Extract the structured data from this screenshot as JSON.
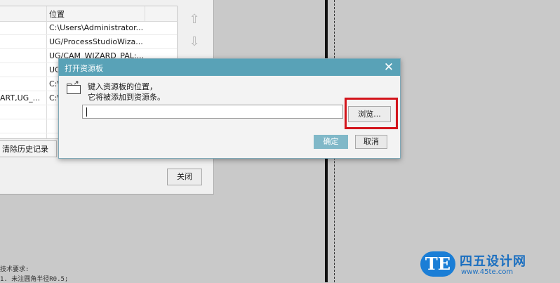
{
  "background_panel": {
    "table": {
      "column_header": "位置",
      "rows": [
        {
          "col1": "",
          "col2": "C:\\Users\\Administrator..."
        },
        {
          "col1": "",
          "col2": "UG/ProcessStudioWiza..."
        },
        {
          "col1": "",
          "col2": "UG/CAM_WIZARD_PAL:..."
        },
        {
          "col1": "",
          "col2": "UG"
        },
        {
          "col1": "",
          "col2": "C:\\"
        },
        {
          "col1": "ART,UG_...",
          "col2": "C:\\"
        },
        {
          "col1": "",
          "col2": ""
        },
        {
          "col1": "",
          "col2": ""
        },
        {
          "col1": "",
          "col2": ""
        }
      ]
    },
    "move_up_icon": "⇧",
    "move_down_icon": "⇩",
    "clear_history_label": "清除历史记录",
    "close_label": "关闭"
  },
  "tech_notes": [
    "技术要求:",
    "1. 未注圆角半径R0.5;"
  ],
  "dialog": {
    "title": "打开资源板",
    "close_glyph": "✕",
    "message_line1": "键入资源板的位置，",
    "message_line2": "它将被添加到资源条。",
    "path_value": "",
    "browse_label": "浏览...",
    "ok_label": "确定",
    "cancel_label": "取消"
  },
  "watermark": {
    "badge": "TE",
    "name": "四五设计网",
    "url": "www.45te.com"
  },
  "colors": {
    "titlebar": "#59a2b7",
    "highlight": "#d3141b",
    "ok_button": "#80b8c8",
    "watermark": "#1b7ed6"
  }
}
